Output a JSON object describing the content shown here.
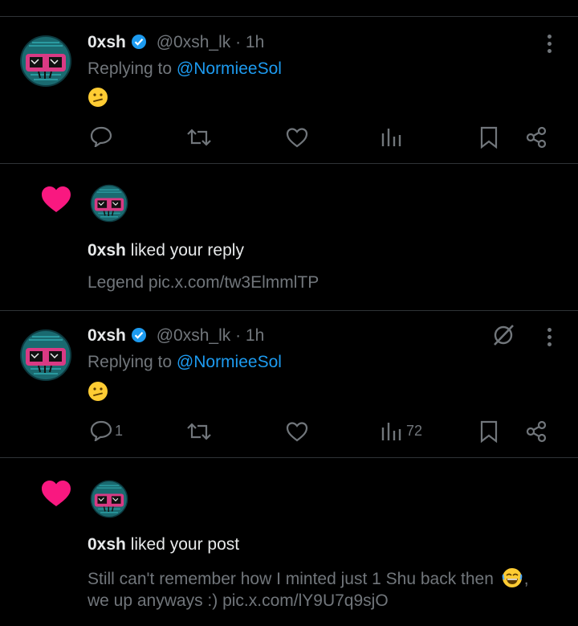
{
  "replies": [
    {
      "author_name": "0xsh",
      "handle": "@0xsh_lk",
      "time": "· 1h",
      "replying_prefix": "Replying to",
      "replying_to": "@NormieeSol",
      "reply_count": "",
      "views": ""
    },
    {
      "author_name": "0xsh",
      "handle": "@0xsh_lk",
      "time": "· 1h",
      "replying_prefix": "Replying to",
      "replying_to": "@NormieeSol",
      "reply_count": "1",
      "views": "72"
    }
  ],
  "notifications": [
    {
      "author_name": "0xsh",
      "action_text": "liked your reply",
      "preview_lines": [
        "Legend pic.x.com/tw3ElmmlTP"
      ]
    },
    {
      "author_name": "0xsh",
      "action_text": "liked your post",
      "preview_lines": [
        "Still can't remember how I minted just 1 Shu back then",
        "we up anyways :) pic.x.com/lY9U7q9sjO"
      ]
    }
  ],
  "colors": {
    "background": "#000000",
    "divider": "#2f3336",
    "primary_text": "#e7e9ea",
    "secondary_text": "#71767b",
    "link": "#1d9bf0",
    "like_pink": "#f91880",
    "verified": "#1d9bf0"
  },
  "icons": [
    "reply-icon",
    "retweet-icon",
    "like-icon",
    "views-icon",
    "bookmark-icon",
    "share-icon",
    "more-icon",
    "verified-badge-icon",
    "grok-icon",
    "heart-notification-icon",
    "confused-emoji",
    "joy-emoji"
  ]
}
